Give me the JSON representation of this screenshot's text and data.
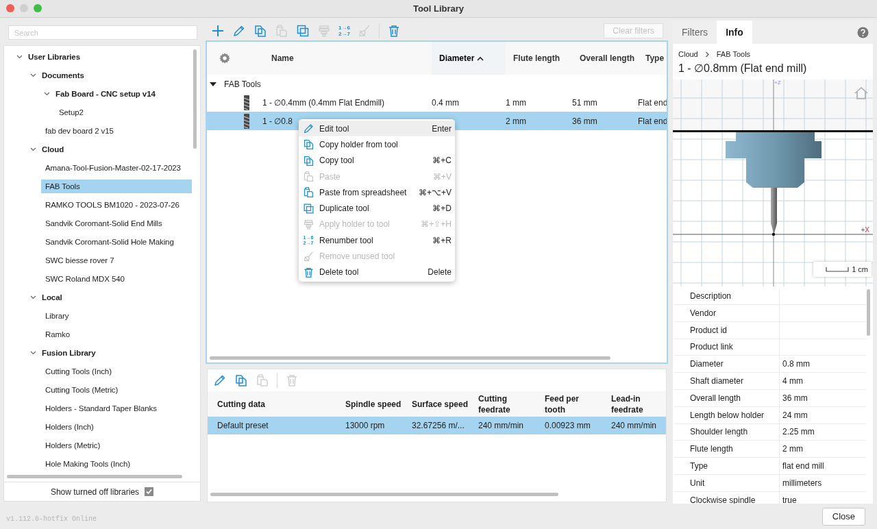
{
  "window": {
    "title": "Tool Library"
  },
  "sidebar": {
    "search": {
      "placeholder": "Search"
    },
    "tree": [
      {
        "label": "User Libraries",
        "expanded": true,
        "selected": false,
        "children": [
          {
            "label": "Documents",
            "expanded": true,
            "selected": false,
            "children": [
              {
                "label": "Fab Board - CNC setup v14",
                "expanded": true,
                "selected": false,
                "children": [
                  {
                    "label": "Setup2",
                    "selected": false
                  }
                ]
              },
              {
                "label": "fab dev board 2 v15",
                "selected": false
              }
            ]
          },
          {
            "label": "Cloud",
            "expanded": true,
            "selected": false,
            "children": [
              {
                "label": "Amana-Tool-Fusion-Master-02-17-2023",
                "selected": false
              },
              {
                "label": "FAB Tools",
                "selected": true
              },
              {
                "label": "RAMKO TOOLS BM1020 - 2023-07-26",
                "selected": false
              },
              {
                "label": "Sandvik Coromant-Solid End Mills",
                "selected": false
              },
              {
                "label": "Sandvik Coromant-Solid Hole Making",
                "selected": false
              },
              {
                "label": "SWC biesse rover 7",
                "selected": false
              },
              {
                "label": "SWC Roland MDX 540",
                "selected": false
              }
            ]
          },
          {
            "label": "Local",
            "expanded": true,
            "selected": false,
            "children": [
              {
                "label": "Library",
                "selected": false
              },
              {
                "label": "Ramko",
                "selected": false
              }
            ]
          },
          {
            "label": "Fusion Library",
            "expanded": true,
            "selected": false,
            "children": [
              {
                "label": "Cutting Tools (Inch)",
                "selected": false
              },
              {
                "label": "Cutting Tools (Metric)",
                "selected": false
              },
              {
                "label": "Holders - Standard Taper Blanks",
                "selected": false
              },
              {
                "label": "Holders (Inch)",
                "selected": false
              },
              {
                "label": "Holders (Metric)",
                "selected": false
              },
              {
                "label": "Hole Making Tools (Inch)",
                "selected": false
              }
            ]
          }
        ]
      }
    ],
    "show_turned_off": {
      "label": "Show turned off libraries",
      "checked": true
    }
  },
  "toolbar": [
    {
      "kind": "add",
      "disabled": false
    },
    {
      "kind": "edit",
      "disabled": false
    },
    {
      "kind": "copy",
      "disabled": false
    },
    {
      "kind": "paste",
      "disabled": true
    },
    {
      "kind": "duplicate",
      "disabled": false
    },
    {
      "kind": "holder",
      "disabled": true
    },
    {
      "kind": "renumber",
      "disabled": false,
      "glyph": [
        "1→6",
        "2→7"
      ]
    },
    {
      "kind": "cleanup",
      "disabled": true
    },
    {
      "kind": "separator"
    },
    {
      "kind": "delete",
      "disabled": false
    }
  ],
  "clear_filters": {
    "label": "Clear filters",
    "disabled": true
  },
  "tool_table": {
    "columns": [
      {
        "label": "Name",
        "sorted": false
      },
      {
        "label": "Diameter",
        "sorted": true
      },
      {
        "label": "Flute length",
        "sorted": false
      },
      {
        "label": "Overall length",
        "sorted": false
      },
      {
        "label": "Type",
        "sorted": false
      }
    ],
    "groups": [
      {
        "label": "FAB Tools",
        "expanded": true,
        "rows": [
          {
            "name": "1 - ∅0.4mm (0.4mm Flat Endmill)",
            "diameter": "0.4 mm",
            "flute_length": "1 mm",
            "overall_length": "51 mm",
            "type": "Flat end",
            "selected": false
          },
          {
            "name": "1 - ∅0.8",
            "flute_length": "2 mm",
            "overall_length": "36 mm",
            "type": "Flat end",
            "selected": true
          }
        ]
      }
    ]
  },
  "context_menu": [
    {
      "kind": "edit",
      "label": "Edit tool",
      "shortcut": "Enter",
      "disabled": false,
      "selected": true
    },
    {
      "kind": "copy",
      "label": "Copy holder from tool",
      "disabled": false,
      "selected": false
    },
    {
      "kind": "copy",
      "label": "Copy tool",
      "shortcut": "⌘+C",
      "disabled": false,
      "selected": false
    },
    {
      "kind": "paste",
      "label": "Paste",
      "shortcut": "⌘+V",
      "disabled": true,
      "selected": false
    },
    {
      "kind": "paste",
      "label": "Paste from spreadsheet",
      "shortcut": "⌘+⌥+V",
      "disabled": false,
      "selected": false
    },
    {
      "kind": "duplicate",
      "label": "Duplicate tool",
      "shortcut": "⌘+D",
      "disabled": false,
      "selected": false
    },
    {
      "kind": "holder",
      "label": "Apply holder to tool",
      "shortcut": "⌘+⇧+H",
      "disabled": true,
      "selected": false
    },
    {
      "kind": "renumber",
      "glyph": [
        "1→6",
        "2→7"
      ],
      "label": "Renumber tool",
      "shortcut": "⌘+R",
      "disabled": false,
      "selected": false
    },
    {
      "kind": "cleanup",
      "label": "Remove unused tool",
      "disabled": true,
      "selected": false
    },
    {
      "kind": "delete",
      "label": "Delete tool",
      "shortcut": "Delete",
      "disabled": false,
      "selected": false
    }
  ],
  "preset_toolbar": [
    {
      "kind": "edit",
      "disabled": false
    },
    {
      "kind": "copy",
      "disabled": false
    },
    {
      "kind": "paste",
      "disabled": true
    },
    {
      "kind": "separator"
    },
    {
      "kind": "delete",
      "disabled": true
    }
  ],
  "preset_table": {
    "columns": [
      "Cutting data",
      "Spindle speed",
      "Surface speed",
      "Cutting feedrate",
      "Feed per tooth",
      "Lead-in feedrate"
    ],
    "rows": [
      {
        "cells": [
          "Default preset",
          "13000 rpm",
          "32.67256 m/...",
          "240 mm/min",
          "0.00923 mm",
          "240 mm/min"
        ],
        "selected": true
      }
    ]
  },
  "info_panel": {
    "tabs": [
      {
        "label": "Filters",
        "selected": false
      },
      {
        "label": "Info",
        "selected": true
      }
    ],
    "breadcrumb": [
      "Cloud",
      "FAB Tools"
    ],
    "title": "1 - ∅0.8mm (Flat end mill)",
    "preview": {
      "z_label": "+Z",
      "x_label": "+X",
      "scale": "1 cm"
    },
    "properties": [
      {
        "label": "Description"
      },
      {
        "label": "Vendor"
      },
      {
        "label": "Product id"
      },
      {
        "label": "Product link"
      },
      {
        "label": "Diameter",
        "value": "0.8 mm"
      },
      {
        "label": "Shaft diameter",
        "value": "4 mm"
      },
      {
        "label": "Overall length",
        "value": "36 mm"
      },
      {
        "label": "Length below holder",
        "value": "24 mm"
      },
      {
        "label": "Shoulder length",
        "value": "2.25 mm"
      },
      {
        "label": "Flute length",
        "value": "2 mm"
      },
      {
        "label": "Type",
        "value": "flat end mill"
      },
      {
        "label": "Unit",
        "value": "millimeters"
      },
      {
        "label": "Clockwise spindle",
        "value": "true"
      }
    ]
  },
  "footer": {
    "version": "v1.112.6-hotfix Online",
    "close": "Close"
  }
}
